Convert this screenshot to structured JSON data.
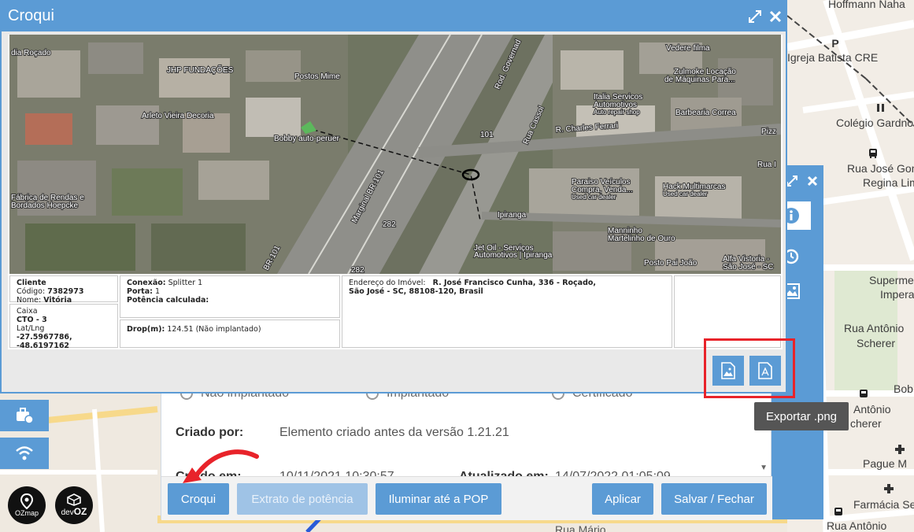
{
  "map": {
    "labels": {
      "hoffmann": "Hoffmann Naha",
      "igreja": "Igreja Batista CRE",
      "colegio": "Colégio Gardno",
      "rua_jose_1": "Rua José Gonzag",
      "rua_jose_2": "Regina Lima",
      "superm_1": "Superme",
      "superm_2": "Impera",
      "rua_antonio_1": "Rua Antônio",
      "rua_antonio_2": "Scherer",
      "bob": "Bob",
      "antonio2_1": "Antônio",
      "antonio2_2": "cherer",
      "pague": "Pague M",
      "farmacia": "Farmácia Se",
      "rua_antonio3": "Rua Antônio",
      "rua_mario": "Rua Mário"
    },
    "poi_p": "P"
  },
  "croqui": {
    "title": "Croqui",
    "satellite_labels": {
      "rocado": "dia Roçado",
      "jhp": "JHP FUNDAÇÕES",
      "postos": "Postos Mime",
      "arleto": "Arleto Vieira Decoria",
      "bobby": "Bobby auto-peruer",
      "fabrica_1": "Fábrica de Rendas e",
      "fabrica_2": "Bordados Hoepcke",
      "marginal": "Marginal BR-101",
      "rod_gov": "Rod. Governad",
      "rua_cassol": "Rua Cassol",
      "charles": "R. Charles Ferrari",
      "vedere": "Vedere filma",
      "zulmoke_1": "Zulmoke Locação",
      "zulmoke_2": "de Máquinas Para...",
      "italia_1": "Italia Servicos",
      "italia_2": "Automotivos",
      "italia_3": "Auto repair shop",
      "barbearia": "Barbearia Correa",
      "paraiso_1": "Paraiso Veículos",
      "paraiso_2": "Compra, Venda...",
      "paraiso_3": "Used car dealer",
      "hack_1": "Hack Multimarcas",
      "hack_2": "Used car dealer",
      "ipiranga": "Ipiranga",
      "jetoil_1": "Jet Oil - Serviços",
      "jetoil_2": "Automotivos | Ipiranga",
      "manninho_1": "Manninho",
      "manninho_2": "Martelinho de Ouro",
      "posto_pai": "Posto Pai João",
      "alfa_1": "Alfa Vistoria -",
      "alfa_2": "São José - SC",
      "pizz": "Pizz",
      "rua_i": "Rua I",
      "r282a": "282",
      "r282b": "282",
      "r101": "101",
      "br101": "BR-101"
    },
    "info": {
      "cliente_label": "Cliente",
      "codigo_label": "Código:",
      "codigo_value": "7382973",
      "nome_label": "Nome:",
      "nome_value": "Vitória",
      "caixa_label": "Caixa",
      "cto_value": "CTO - 3",
      "latlng_label": "Lat/Lng",
      "lat_value": "-27.5967786,",
      "lng_value": "-48.6197162",
      "conexao_label": "Conexão:",
      "conexao_value": "Splitter 1",
      "porta_label": "Porta:",
      "porta_value": "1",
      "potencia_label": "Potência calculada:",
      "drop_label": "Drop(m):",
      "drop_value": "124.51 (Não implantado)",
      "endereco_label": "Endereço do Imóvel:",
      "endereco_value_1": "R. José Francisco Cunha, 336 - Roçado,",
      "endereco_value_2": "São José - SC, 88108-120, Brasil"
    },
    "tooltip": "Exportar .png"
  },
  "form": {
    "radio_1": "Não implantado",
    "radio_2": "Implantado",
    "radio_3": "Certificado",
    "criado_label": "Criado por:",
    "criado_value": "Elemento criado antes da versão 1.21.21",
    "criado_em_label": "Criado em:",
    "criado_em_value": "10/11/2021 10:30:57",
    "atualizado_label": "Atualizado em:",
    "atualizado_value": "14/07/2022 01:05:09"
  },
  "buttons": {
    "croqui": "Croqui",
    "extrato": "Extrato de potência",
    "iluminar": "Iluminar até a POP",
    "aplicar": "Aplicar",
    "salvar": "Salvar / Fechar"
  },
  "logos": {
    "ozmap": "OZmap",
    "devoz_dev": "dev",
    "devoz_oz": "OZ"
  },
  "colors": {
    "accent": "#5b9bd5",
    "highlight": "#e8232a",
    "arrow": "#e8232a"
  }
}
